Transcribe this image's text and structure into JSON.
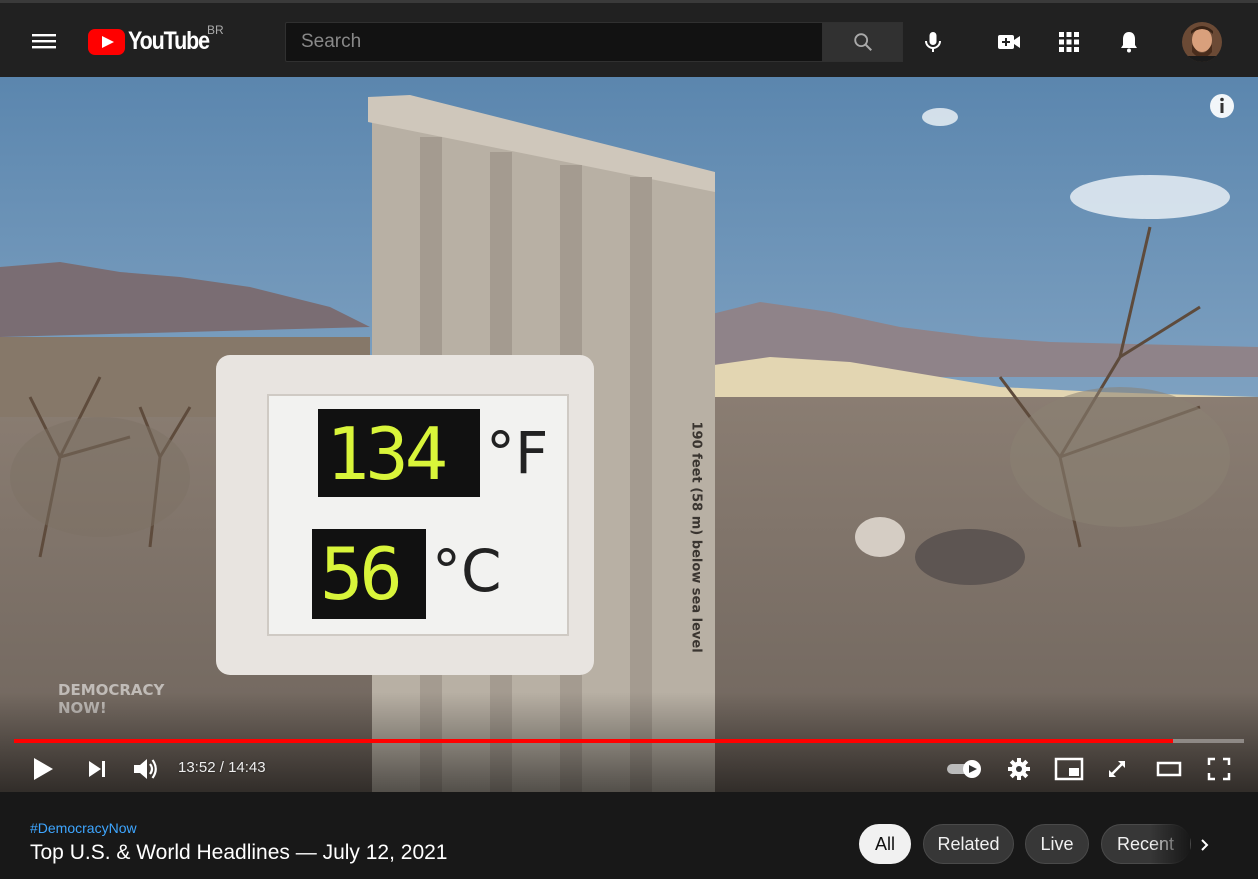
{
  "masthead": {
    "logo_text": "YouTube",
    "country_code": "BR",
    "search_placeholder": "Search",
    "icons": [
      "menu-icon",
      "search-icon",
      "microphone-icon",
      "create-video-icon",
      "apps-grid-icon",
      "notifications-bell-icon",
      "avatar"
    ]
  },
  "player": {
    "current_time": "13:52",
    "separator": " / ",
    "duration": "14:43",
    "time_display": "13:52 / 14:43",
    "progress_fraction": 0.9423,
    "watermark": "DEMOCRACY NOW!",
    "sign_fahrenheit": "134",
    "sign_fahrenheit_unit": "°F",
    "sign_celsius": "56",
    "sign_celsius_unit": "°C",
    "pole_text": "190 feet (58 m) below sea level",
    "colors": {
      "progress": "#ff0000",
      "digits": "#d9f53a"
    }
  },
  "video_info": {
    "hashtag": "#DemocracyNow",
    "title": "Top U.S. & World Headlines — July 12, 2021"
  },
  "chips": [
    {
      "label": "All",
      "active": true
    },
    {
      "label": "Related",
      "active": false
    },
    {
      "label": "Live",
      "active": false
    },
    {
      "label": "Recent",
      "active": false
    }
  ]
}
